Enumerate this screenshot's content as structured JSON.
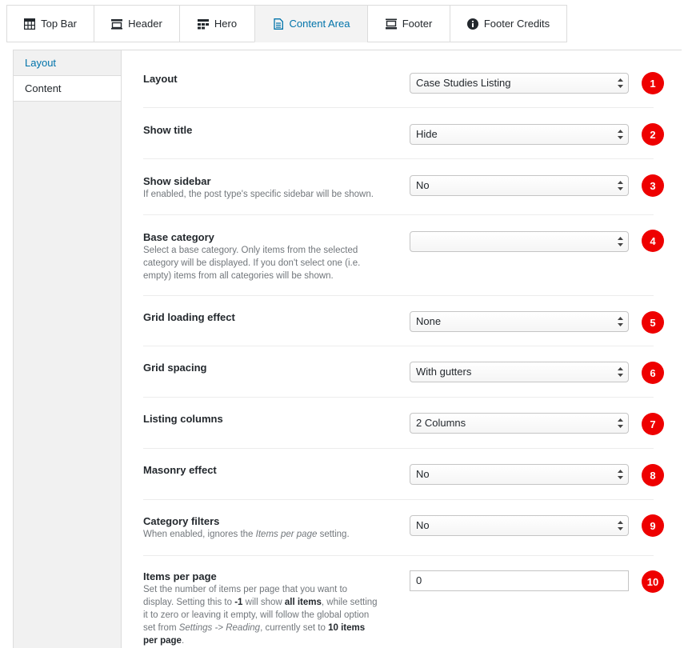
{
  "tabs": [
    {
      "label": "Top Bar",
      "icon": "grid-table-icon"
    },
    {
      "label": "Header",
      "icon": "header-icon"
    },
    {
      "label": "Hero",
      "icon": "hero-grid-icon"
    },
    {
      "label": "Content Area",
      "icon": "document-icon",
      "active": true
    },
    {
      "label": "Footer",
      "icon": "footer-icon"
    },
    {
      "label": "Footer Credits",
      "icon": "info-icon"
    }
  ],
  "subnav": [
    {
      "label": "Layout",
      "active": true
    },
    {
      "label": "Content"
    }
  ],
  "fields": [
    {
      "label": "Layout",
      "value": "Case Studies Listing",
      "badge": "1"
    },
    {
      "label": "Show title",
      "value": "Hide",
      "badge": "2"
    },
    {
      "label": "Show sidebar",
      "description": "If enabled, the post type's specific sidebar will be shown.",
      "value": "No",
      "badge": "3"
    },
    {
      "label": "Base category",
      "description": "Select a base category. Only items from the selected category will be displayed. If you don't select one (i.e. empty) items from all categories will be shown.",
      "value": "",
      "badge": "4"
    },
    {
      "label": "Grid loading effect",
      "value": "None",
      "badge": "5"
    },
    {
      "label": "Grid spacing",
      "value": "With gutters",
      "badge": "6"
    },
    {
      "label": "Listing columns",
      "value": "2 Columns",
      "badge": "7"
    },
    {
      "label": "Masonry effect",
      "value": "No",
      "badge": "8"
    },
    {
      "label": "Category filters",
      "description_parts": [
        "When enabled, ignores the ",
        "Items per page",
        " setting."
      ],
      "value": "No",
      "badge": "9"
    },
    {
      "label": "Items per page",
      "description_parts": [
        "Set the number of items per page that you want to display. Setting this to ",
        "-1",
        " will show ",
        "all items",
        ", while setting it to zero or leaving it empty, will follow the global option set from ",
        "Settings -> Reading",
        ", currently set to ",
        "10 items per page",
        "."
      ],
      "value": "0",
      "badge": "10"
    }
  ],
  "colors": {
    "accent": "#0073aa",
    "badge": "#ee0000"
  }
}
